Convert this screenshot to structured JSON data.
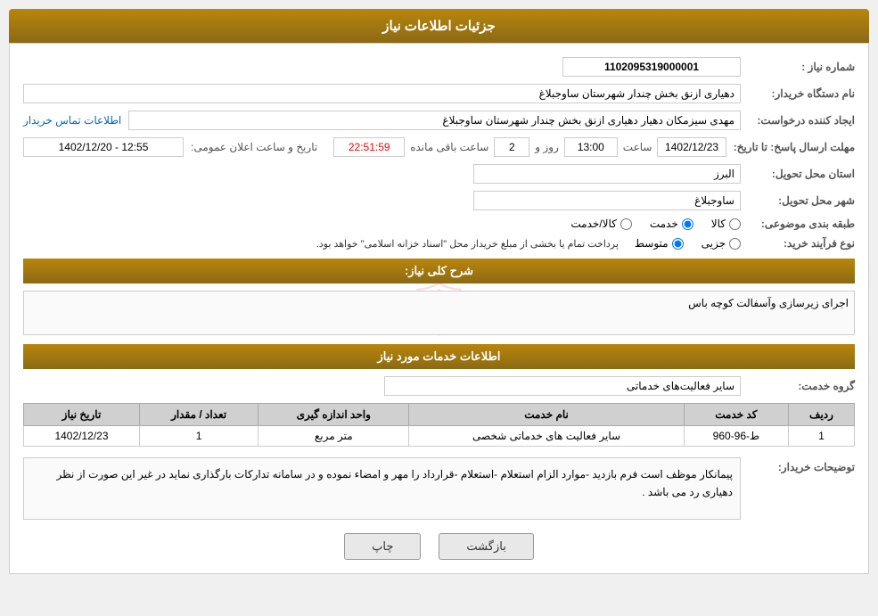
{
  "header": {
    "title": "جزئیات اطلاعات نیاز"
  },
  "fields": {
    "need_number_label": "شماره نیاز :",
    "need_number_value": "1102095319000001",
    "buyer_label": "نام دستگاه خریدار:",
    "buyer_value": "دهیاری ازنق بخش چندار شهرستان ساوجبلاغ",
    "creator_label": "ایجاد کننده درخواست:",
    "creator_value": "مهدی سیزمکان دهیار دهیاری ازنق بخش چندار شهرستان ساوجبلاغ",
    "contact_link": "اطلاعات تماس خریدار",
    "deadline_label": "مهلت ارسال پاسخ: تا تاریخ:",
    "deadline_date": "1402/12/23",
    "deadline_time_label": "ساعت",
    "deadline_time": "13:00",
    "days_label": "روز و",
    "days_value": "2",
    "remaining_label": "ساعت باقی مانده",
    "remaining_time": "22:51:59",
    "public_announce_label": "تاریخ و ساعت اعلان عمومی:",
    "public_announce_value": "1402/12/20 - 12:55",
    "province_label": "استان محل تحویل:",
    "province_value": "البرز",
    "city_label": "شهر محل تحویل:",
    "city_value": "ساوجبلاغ",
    "category_label": "طبقه بندی موضوعی:",
    "category_options": [
      "کالا",
      "خدمت",
      "کالا/خدمت"
    ],
    "category_selected": "خدمت",
    "purchase_type_label": "نوع فرآیند خرید:",
    "purchase_options": [
      "جزیی",
      "متوسط"
    ],
    "purchase_selected": "متوسط",
    "purchase_note": "پرداخت تمام یا بخشی از مبلغ خریداز محل \"اسناد خزانه اسلامی\" خواهد بود.",
    "description_label": "شرح کلی نیاز:",
    "description_value": "اجرای زیرسازی وآسفالت کوچه باس"
  },
  "services_section": {
    "title": "اطلاعات خدمات مورد نیاز",
    "group_label": "گروه خدمت:",
    "group_value": "سایر فعالیت‌های خدماتی",
    "table": {
      "headers": [
        "ردیف",
        "کد خدمت",
        "نام خدمت",
        "واحد اندازه گیری",
        "تعداد / مقدار",
        "تاریخ نیاز"
      ],
      "rows": [
        {
          "row_num": "1",
          "code": "ط-96-960",
          "name": "سایر فعالیت های خدماتی شخصی",
          "unit": "متر مربع",
          "quantity": "1",
          "date": "1402/12/23"
        }
      ]
    }
  },
  "notes_section": {
    "label": "توضیحات خریدار:",
    "text": "پیمانکار موظف است فرم بازدید -موارد الزام استعلام -استعلام -قرارداد را مهر و امضاء نموده و در سامانه تداركات بارگذاری نماید در غیر این صورت از نظر دهیاری رد می باشد ."
  },
  "buttons": {
    "print": "چاپ",
    "back": "بازگشت"
  }
}
